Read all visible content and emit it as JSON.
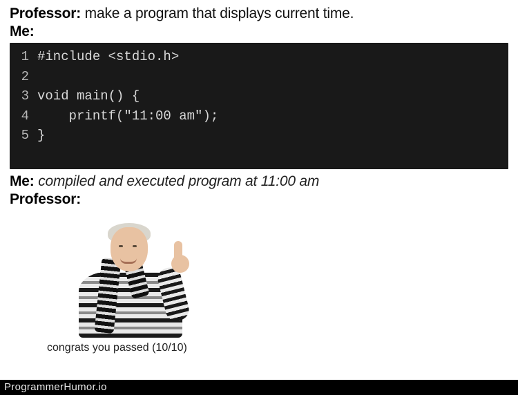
{
  "dialogue": {
    "prof1": {
      "speaker": "Professor:",
      "text": " make a program that displays current time."
    },
    "me1": {
      "speaker": "Me:",
      "text": ""
    },
    "me2": {
      "speaker": "Me:",
      "text": " compiled and executed program at 11:00 am"
    },
    "prof2": {
      "speaker": "Professor:",
      "text": ""
    }
  },
  "code": {
    "l1": {
      "n": "1",
      "t": "#include <stdio.h>"
    },
    "l2": {
      "n": "2",
      "t": ""
    },
    "l3": {
      "n": "3",
      "t": "void main() {"
    },
    "l4": {
      "n": "4",
      "t": "    printf(\"11:00 am\");"
    },
    "l5": {
      "n": "5",
      "t": "}"
    }
  },
  "caption": "congrats you passed (10/10)",
  "watermark": "ProgrammerHumor.io"
}
